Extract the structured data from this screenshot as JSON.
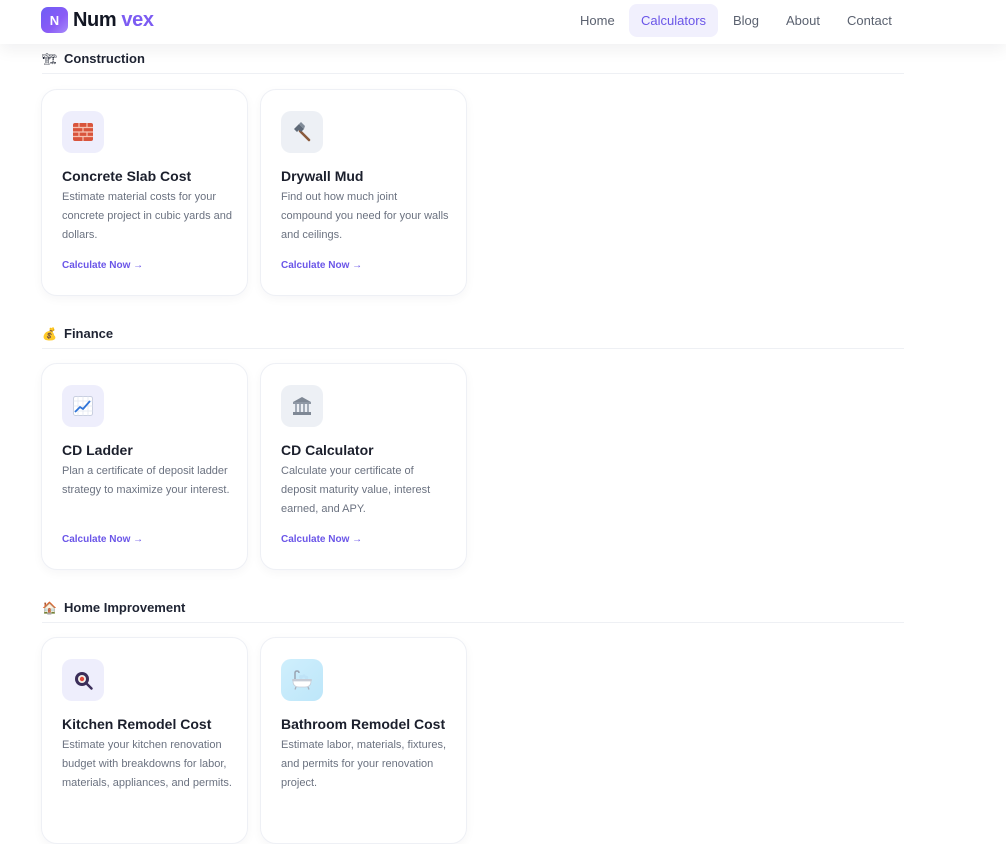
{
  "brand": {
    "mark": "N",
    "name_part1": "Num",
    "name_part2": "vex",
    "accent_color": "#7c5cf2"
  },
  "nav": {
    "items": [
      {
        "label": "Home",
        "active": false
      },
      {
        "label": "Calculators",
        "active": true
      },
      {
        "label": "Blog",
        "active": false
      },
      {
        "label": "About",
        "active": false
      },
      {
        "label": "Contact",
        "active": false
      }
    ]
  },
  "sections": [
    {
      "emoji": "🏗",
      "title": "Construction",
      "cards": [
        {
          "icon": "brick-icon",
          "title": "Concrete Slab Cost",
          "description": "Estimate material costs for your concrete project in cubic yards and dollars.",
          "cta": "Calculate Now →"
        },
        {
          "icon": "hammer-icon",
          "title": "Drywall Mud",
          "description": "Find out how much joint compound you need for your walls and ceilings.",
          "cta": "Calculate Now →"
        }
      ]
    },
    {
      "emoji": "💰",
      "title": "Finance",
      "cards": [
        {
          "icon": "chart-increasing-icon",
          "title": "CD Ladder",
          "description": "Plan a certificate of deposit ladder strategy to maximize your interest.",
          "cta": "Calculate Now →"
        },
        {
          "icon": "bank-icon",
          "title": "CD Calculator",
          "description": "Calculate your certificate of deposit maturity value, interest earned, and APY.",
          "cta": "Calculate Now →"
        }
      ]
    },
    {
      "emoji": "🏠",
      "title": "Home Improvement",
      "cards": [
        {
          "icon": "kitchen-icon",
          "title": "Kitchen Remodel Cost",
          "description": "Estimate your kitchen renovation budget with breakdowns for labor, materials, appliances, and permits.",
          "cta": ""
        },
        {
          "icon": "bathtub-icon",
          "title": "Bathroom Remodel Cost",
          "description": "Estimate labor, materials, fixtures, and permits for your renovation project.",
          "cta": ""
        }
      ]
    }
  ]
}
